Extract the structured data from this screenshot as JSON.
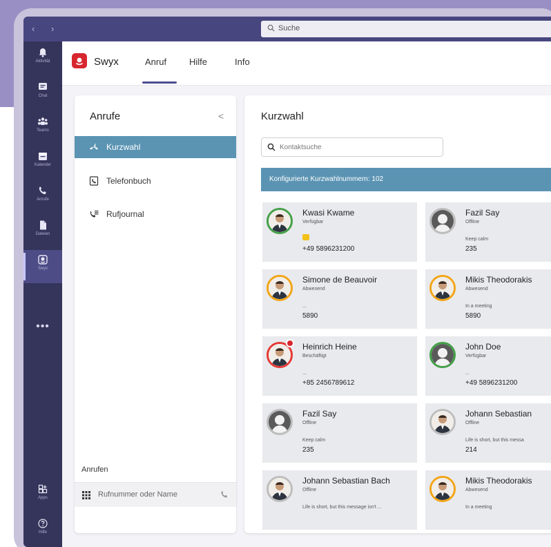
{
  "search": {
    "placeholder": "Suche"
  },
  "rail": {
    "items": [
      {
        "label": "Aktivität",
        "icon": "bell-icon"
      },
      {
        "label": "Chat",
        "icon": "chat-icon"
      },
      {
        "label": "Teams",
        "icon": "teams-icon"
      },
      {
        "label": "Kalender",
        "icon": "calendar-icon"
      },
      {
        "label": "Anrufe",
        "icon": "phone-icon"
      },
      {
        "label": "Dateien",
        "icon": "file-icon"
      },
      {
        "label": "Swyx",
        "icon": "swyx-icon"
      }
    ],
    "more": "•••",
    "bottom": [
      {
        "label": "Apps",
        "icon": "apps-icon"
      },
      {
        "label": "Hilfe",
        "icon": "help-icon"
      }
    ]
  },
  "app": {
    "brand": "Swyx",
    "tabs": [
      "Anruf",
      "Hilfe",
      "Info"
    ],
    "active_tab": "Anruf",
    "brand_color": "#d8262e"
  },
  "left": {
    "title": "Anrufe",
    "chevron": "<",
    "items": [
      {
        "label": "Kurzwahl",
        "icon": "speed-dial-icon",
        "active": true
      },
      {
        "label": "Telefonbuch",
        "icon": "phonebook-icon",
        "active": false
      },
      {
        "label": "Rufjournal",
        "icon": "call-journal-icon",
        "active": false
      }
    ],
    "call_label": "Anrufen",
    "dial_placeholder": "Rufnummer oder Name"
  },
  "main": {
    "title": "Kurzwahl",
    "search_placeholder": "Kontaktsuche",
    "banner": "Konfigurierte Kurzwahlnummern: 102",
    "accent": "#5b94b3",
    "contacts": [
      {
        "name": "Kwasi Kwame",
        "status": "Verfügbar",
        "note": "",
        "number": "+49 5896231200",
        "ring": "#43a047",
        "emoji": true,
        "badge": false,
        "avatar": "person"
      },
      {
        "name": "Fazil Say",
        "status": "Offline",
        "note": "Keep calm",
        "number": "235",
        "ring": "#bdbdbd",
        "emoji": false,
        "badge": false,
        "avatar": "placeholder"
      },
      {
        "name": "Simone de Beauvoir",
        "status": "Abwesend",
        "note": "...",
        "number": "5890",
        "ring": "#f2a516",
        "emoji": false,
        "badge": false,
        "avatar": "person"
      },
      {
        "name": "Mikis Theodorakis",
        "status": "Abwesend",
        "note": "In a meeting",
        "number": "5890",
        "ring": "#f2a516",
        "emoji": false,
        "badge": false,
        "avatar": "person"
      },
      {
        "name": "Heinrich Heine",
        "status": "Beschäftigt",
        "note": "...",
        "number": "+85 2456789612",
        "ring": "#e53935",
        "emoji": false,
        "badge": true,
        "avatar": "person"
      },
      {
        "name": "John Doe",
        "status": "Verfügbar",
        "note": "...",
        "number": "+49 5896231200",
        "ring": "#43a047",
        "emoji": false,
        "badge": false,
        "avatar": "placeholder"
      },
      {
        "name": "Fazil Say",
        "status": "Offline",
        "note": "Keep calm",
        "number": "235",
        "ring": "#bdbdbd",
        "emoji": false,
        "badge": false,
        "avatar": "placeholder"
      },
      {
        "name": "Johann Sebastian",
        "status": "Offline",
        "note": "Life is short, but this messa",
        "number": "214",
        "ring": "#bdbdbd",
        "emoji": false,
        "badge": false,
        "avatar": "person"
      },
      {
        "name": "Johann Sebastian Bach",
        "status": "Offline",
        "note": "Life is short, but this message isn't ...",
        "number": "",
        "ring": "#bdbdbd",
        "emoji": false,
        "badge": false,
        "avatar": "person"
      },
      {
        "name": "Mikis Theodorakis",
        "status": "Abwesend",
        "note": "In a meeting",
        "number": "",
        "ring": "#f2a516",
        "emoji": false,
        "badge": false,
        "avatar": "person"
      }
    ]
  }
}
